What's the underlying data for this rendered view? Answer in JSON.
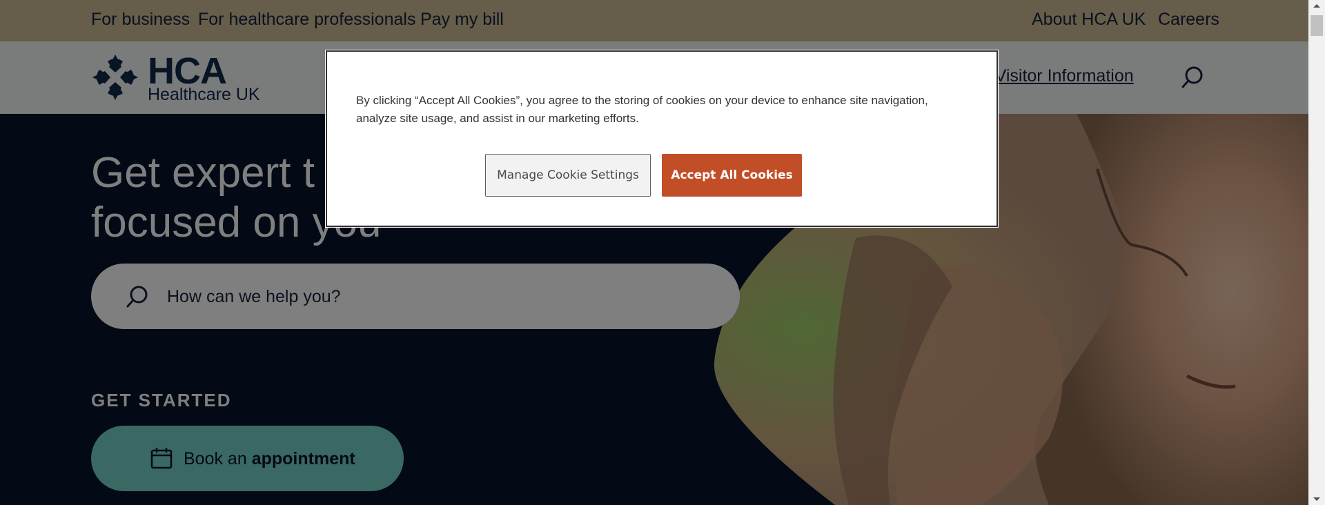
{
  "utility_bar": {
    "links": [
      "For business",
      "For healthcare professionals",
      "Pay my bill",
      "About HCA UK",
      "Careers"
    ]
  },
  "header": {
    "logo_word": "HCA",
    "logo_sub": "Healthcare UK",
    "nav_item": "& Visitor Information"
  },
  "hero": {
    "title_line1": "Get expert t",
    "title_line2": "focused on you",
    "search_placeholder": "How can we help you?",
    "get_started": "GET STARTED",
    "book_button_prefix": "Book an",
    "book_button_bold": "appointment"
  },
  "cookie_dialog": {
    "text": "By clicking “Accept All Cookies”, you agree to the storing of cookies on your device to enhance site navigation, analyze site usage, and assist in our marketing efforts.",
    "manage_label": "Manage Cookie Settings",
    "accept_label": "Accept All Cookies"
  },
  "colors": {
    "utility_bar": "#cdbb95",
    "hero_background": "#06132b",
    "book_button": "#74d0c4",
    "accept_button": "#c14e27"
  },
  "icons": {
    "search": "search-icon",
    "calendar": "calendar-icon",
    "logo": "hca-cross-logo-icon"
  }
}
